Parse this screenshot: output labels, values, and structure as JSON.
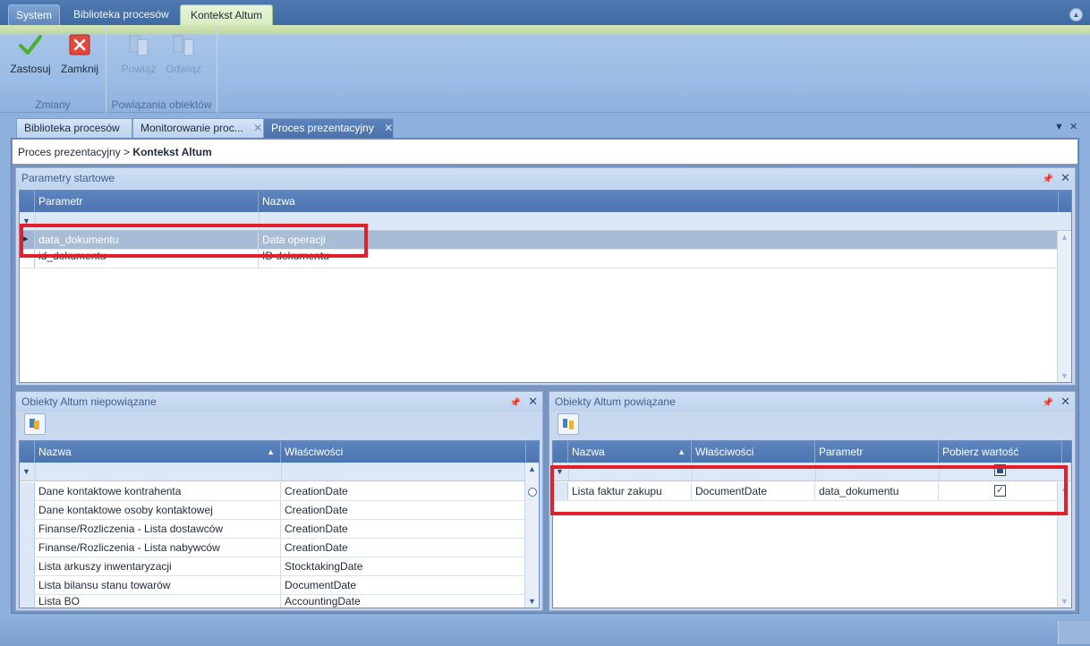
{
  "ribbon": {
    "tabs": [
      "System",
      "Biblioteka procesów",
      "Kontekst Altum"
    ],
    "groups": [
      {
        "label": "Zmiany",
        "buttons": [
          "Zastosuj",
          "Zamknij"
        ]
      },
      {
        "label": "Powiązania obiektów",
        "buttons": [
          "Powiąż",
          "Odwiąż"
        ]
      }
    ]
  },
  "doc_tabs": [
    {
      "label": "Biblioteka procesów"
    },
    {
      "label": "Monitorowanie proc...",
      "close": "✕"
    },
    {
      "label": "Proces prezentacyjny",
      "close": "✕"
    }
  ],
  "breadcrumb": {
    "path": "Proces prezentacyjny >",
    "current": "Kontekst Altum"
  },
  "start_params": {
    "title": "Parametry startowe",
    "columns": [
      "Parametr",
      "Nazwa"
    ],
    "rows": [
      {
        "param": "data_dokumentu",
        "name": "Data operacji"
      },
      {
        "param": "id_dokumentu",
        "name": "ID dokumentu"
      }
    ]
  },
  "unlinked": {
    "title": "Obiekty Altum niepowiązane",
    "columns": [
      "Nazwa",
      "Właściwości"
    ],
    "rows": [
      {
        "name": "Dane kontaktowe kontrahenta",
        "prop": "CreationDate"
      },
      {
        "name": "Dane kontaktowe osoby kontaktowej",
        "prop": "CreationDate"
      },
      {
        "name": "Finanse/Rozliczenia - Lista dostawców",
        "prop": "CreationDate"
      },
      {
        "name": "Finanse/Rozliczenia - Lista nabywców",
        "prop": "CreationDate"
      },
      {
        "name": "Lista arkuszy inwentaryzacji",
        "prop": "StocktakingDate"
      },
      {
        "name": "Lista bilansu stanu towarów",
        "prop": "DocumentDate"
      },
      {
        "name": "Lista BO",
        "prop": "AccountingDate"
      }
    ]
  },
  "linked": {
    "title": "Obiekty Altum powiązane",
    "columns": [
      "Nazwa",
      "Właściwości",
      "Parametr",
      "Pobierz wartość"
    ],
    "rows": [
      {
        "name": "Lista faktur zakupu",
        "prop": "DocumentDate",
        "param": "data_dokumentu",
        "fetch": true
      }
    ]
  },
  "icons": {
    "apply": "checkmark-icon",
    "close": "red-x-icon",
    "link": "link-objects-icon",
    "unlink": "unlink-objects-icon"
  },
  "colors": {
    "highlight": "#e0202a",
    "header": "#4b74b0",
    "selected_row": "#a8bcd6"
  }
}
